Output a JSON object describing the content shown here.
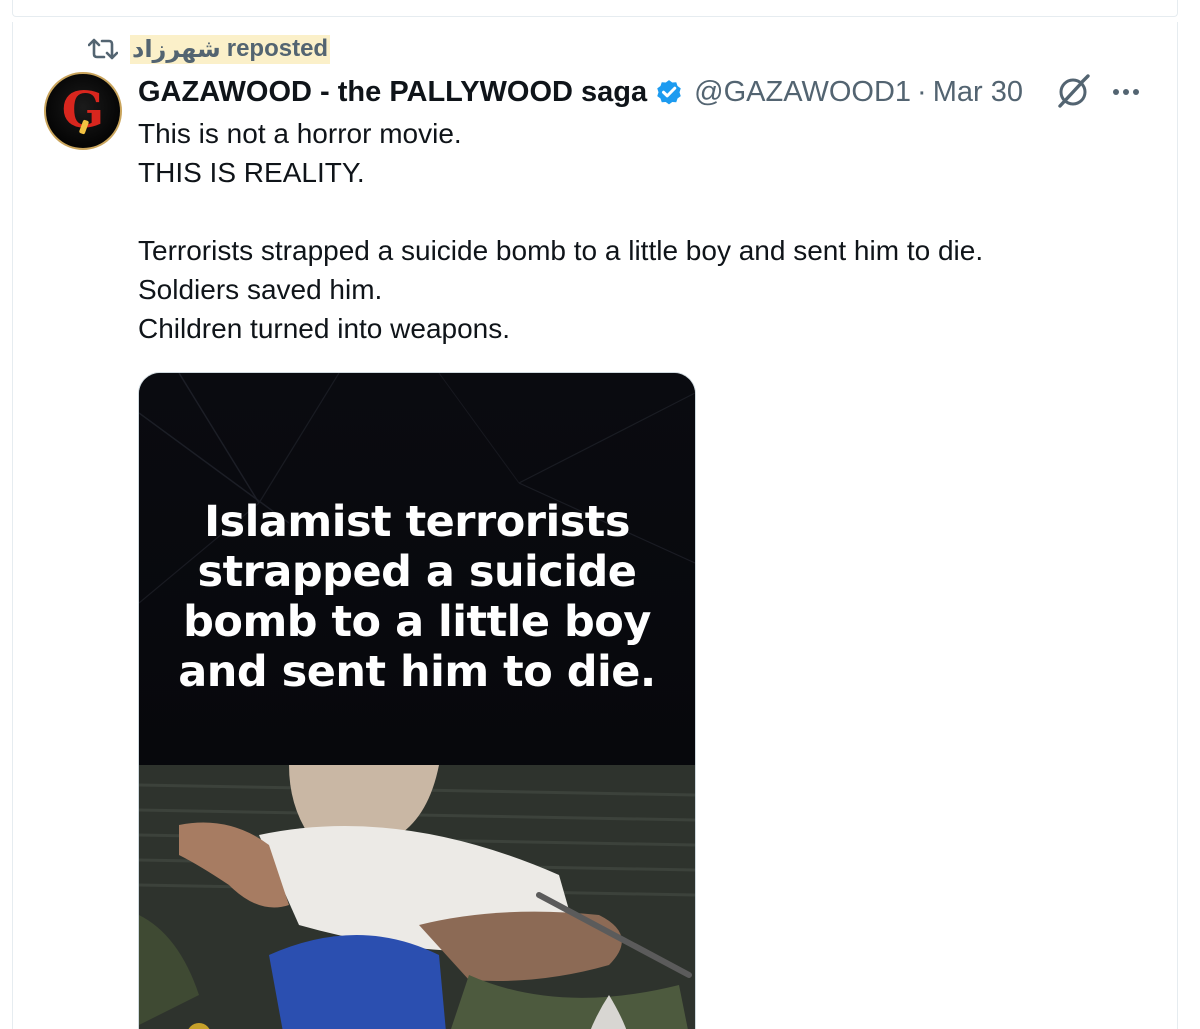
{
  "repost": {
    "name": "شهرزاد",
    "label": "reposted"
  },
  "author": {
    "display_name": "GAZAWOOD - the PALLYWOOD saga",
    "handle": "@GAZAWOOD1",
    "separator": "·",
    "date": "Mar 30",
    "avatar_letter": "G"
  },
  "tweet": {
    "lines": [
      "This is not a horror movie.",
      "THIS IS REALITY.",
      "",
      "Terrorists strapped a suicide bomb to a little boy and sent him to die.",
      "Soldiers saved him.",
      "Children turned into weapons."
    ]
  },
  "media": {
    "overlay_lines": [
      "Islamist terrorists",
      "strapped a suicide",
      "bomb to a little boy",
      "and sent him to die."
    ]
  },
  "icons": {
    "repost": "repost-icon",
    "verified": "verified-badge-icon",
    "grok": "grok-icon",
    "more": "more-options-icon"
  },
  "colors": {
    "text_primary": "#0f1419",
    "text_secondary": "#536471",
    "verified_blue": "#1d9bf0",
    "repost_highlight": "#fbf0c9"
  }
}
